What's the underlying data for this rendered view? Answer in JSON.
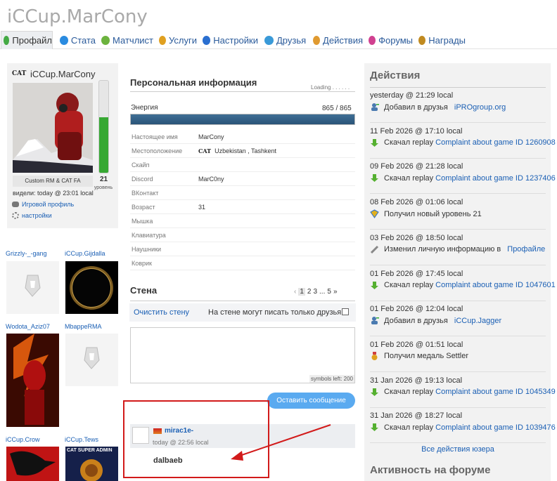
{
  "site_title": "iCCup.MarCony",
  "nav": [
    {
      "label": "Профайл",
      "icon": "profile-icon",
      "color": "#44aa44"
    },
    {
      "label": "Стата",
      "icon": "stats-icon",
      "color": "#2a8be0"
    },
    {
      "label": "Матчлист",
      "icon": "matchlist-icon",
      "color": "#6cb33e"
    },
    {
      "label": "Услуги",
      "icon": "services-icon",
      "color": "#e0a020"
    },
    {
      "label": "Настройки",
      "icon": "settings-icon",
      "color": "#2a6fd0"
    },
    {
      "label": "Друзья",
      "icon": "friends-icon",
      "color": "#3a9ad8"
    },
    {
      "label": "Действия",
      "icon": "actions-icon",
      "color": "#e09a30"
    },
    {
      "label": "Форумы",
      "icon": "forums-icon",
      "color": "#d04090"
    },
    {
      "label": "Награды",
      "icon": "awards-icon",
      "color": "#c08a20"
    }
  ],
  "profile": {
    "tag": "CAT",
    "name": "iCCup.MarCony",
    "title": "Custom RM & CAT FA",
    "level": "21",
    "level_label": "уровень",
    "level_fill": 0.6,
    "seen": "видели: today @ 23:01 local",
    "game_profile": "Игровой профиль",
    "settings": "настройки"
  },
  "friends": [
    {
      "name": "Grizzly-_-gang"
    },
    {
      "name": "iCCup.Gijdalla"
    },
    {
      "name": "Wodota_Aziz07"
    },
    {
      "name": "MbappeRMA"
    },
    {
      "name": "iCCup.Crow"
    },
    {
      "name": "iCCup.Tews",
      "banner": "CAT SUPER ADMIN"
    }
  ],
  "personal": {
    "heading": "Персональная информация",
    "loading": "Loading . . . . . .",
    "energy_label": "Энергия",
    "energy_value": "865 / 865",
    "energy_fill": 1,
    "rows": [
      {
        "k": "Настоящее имя",
        "v": "MarCony"
      },
      {
        "k": "Местоположение",
        "tag": "CAT",
        "v": "Uzbekistan , Tashkent"
      },
      {
        "k": "Скайп",
        "v": ""
      },
      {
        "k": "Discord",
        "v": "MarC0ny"
      },
      {
        "k": "ВКонтакт",
        "v": ""
      },
      {
        "k": "Возраст",
        "v": "31"
      },
      {
        "k": "Мышка",
        "v": ""
      },
      {
        "k": "Клавиатура",
        "v": ""
      },
      {
        "k": "Наушники",
        "v": ""
      },
      {
        "k": "Коврик",
        "v": ""
      }
    ]
  },
  "wall": {
    "heading": "Стена",
    "pager": [
      "‹",
      "1",
      "2",
      "3",
      "...",
      "5",
      "»"
    ],
    "clear": "Очистить стену",
    "friends_only": "На стене могут писать только друзья",
    "symbols": "symbols left: 200",
    "post_button": "Оставить сообщение",
    "message": {
      "author": "mirac1e-",
      "time": "today @ 22:56 local",
      "text": "dalbaeb"
    }
  },
  "actions": {
    "heading": "Действия",
    "items": [
      {
        "date": "yesterday @ 21:29 local",
        "icon": "add-friend-icon",
        "text": "Добавил в друзья",
        "link": "iPROgroup.org",
        "sep": true
      },
      {
        "date": "11 Feb 2026 @ 17:10 local",
        "icon": "download-icon",
        "text": "Скачал replay",
        "link": "Complaint about game ID 1260908"
      },
      {
        "date": "09 Feb 2026 @ 21:28 local",
        "icon": "download-icon",
        "text": "Скачал replay",
        "link": "Complaint about game ID 1237406"
      },
      {
        "date": "08 Feb 2026 @ 01:06 local",
        "icon": "level-icon",
        "text": "Получил новый уровень 21",
        "link": ""
      },
      {
        "date": "03 Feb 2026 @ 18:50 local",
        "icon": "edit-icon",
        "text": "Изменил личную информацию в",
        "link": "Профайле",
        "sep": true
      },
      {
        "date": "01 Feb 2026 @ 17:45 local",
        "icon": "download-icon",
        "text": "Скачал replay",
        "link": "Complaint about game ID 1047601"
      },
      {
        "date": "01 Feb 2026 @ 12:04 local",
        "icon": "add-friend-icon",
        "text": "Добавил в друзья",
        "link": "iCCup.Jagger",
        "sep": true
      },
      {
        "date": "01 Feb 2026 @ 01:51 local",
        "icon": "medal-icon",
        "text": "Получил медаль Settler",
        "link": ""
      },
      {
        "date": "31 Jan 2026 @ 19:13 local",
        "icon": "download-icon",
        "text": "Скачал replay",
        "link": "Complaint about game ID 1045349"
      },
      {
        "date": "31 Jan 2026 @ 18:27 local",
        "icon": "download-icon",
        "text": "Скачал replay",
        "link": "Complaint about game ID 1039476"
      }
    ],
    "all_link": "Все действия юзера",
    "forum_heading": "Активность на форуме"
  }
}
